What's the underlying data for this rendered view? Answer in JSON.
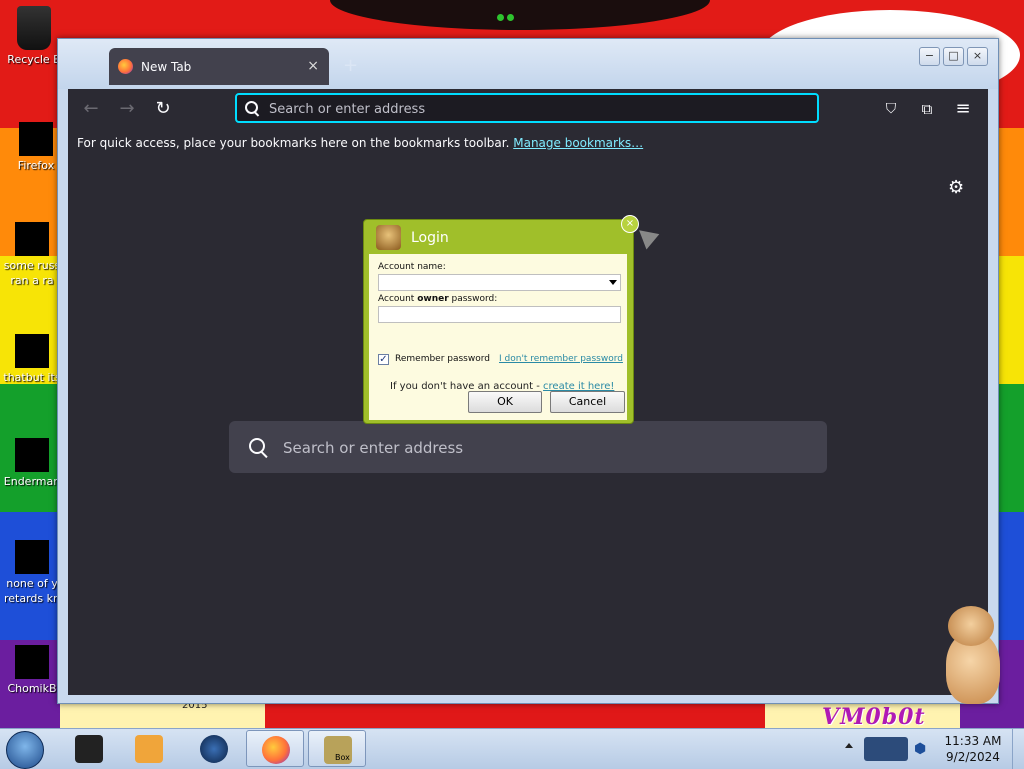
{
  "desktop": {
    "icons": [
      {
        "label": "Recycle B"
      },
      {
        "label": "Firefox"
      },
      {
        "label": "some russ\nran a ra"
      },
      {
        "label": "thatbut its"
      },
      {
        "label": "Enderman"
      },
      {
        "label": "none of y\nretards kn"
      },
      {
        "label": "ChomikB"
      }
    ],
    "wallpaper_text": "VM0b0t",
    "year_text": "2015"
  },
  "browser": {
    "tab_title": "New Tab",
    "tab_close": "×",
    "new_tab": "+",
    "window_controls": {
      "minimize": "−",
      "maximize": "□",
      "close": "×"
    },
    "nav": {
      "back": "←",
      "forward": "→",
      "reload": "↻"
    },
    "urlbar_placeholder": "Search or enter address",
    "toolbar_icons": [
      "pocket-icon",
      "extensions-icon",
      "menu-icon"
    ],
    "bookmarks_text": "For quick access, place your bookmarks here on the bookmarks toolbar.",
    "bookmarks_link": "Manage bookmarks…",
    "content_search_placeholder": "Search or enter address",
    "settings_icon": "gear-icon"
  },
  "login_dialog": {
    "title": "Login",
    "account_name_label": "Account name:",
    "password_label_pre": "Account ",
    "password_label_bold": "owner",
    "password_label_post": " password:",
    "remember_label": "Remember password",
    "remember_checked": true,
    "forgot_link": "I don't remember password",
    "no_account_text": "If you don't have an account - ",
    "create_link": "create it here!",
    "ok": "OK",
    "cancel": "Cancel",
    "accent": "#a0bf2a"
  },
  "taskbar": {
    "time": "11:33 AM",
    "date": "9/2/2024",
    "active_item": "Box"
  }
}
